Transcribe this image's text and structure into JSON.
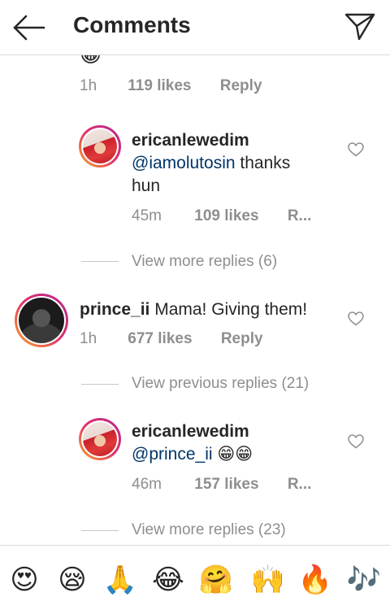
{
  "header": {
    "title": "Comments"
  },
  "top_partial": {
    "emoji": "😀",
    "time": "1h",
    "likes": "119 likes",
    "reply": "Reply"
  },
  "reply1": {
    "username": "ericanlewedim",
    "mention": "@iamolutosin",
    "text_line1": " thanks",
    "text_line2": "hun",
    "time": "45m",
    "likes": "109 likes",
    "reply": "R..."
  },
  "more1": "View more replies (6)",
  "comment2": {
    "username": "prince_ii",
    "text": " Mama! Giving them!",
    "time": "1h",
    "likes": "677 likes",
    "reply": "Reply"
  },
  "previous": "View previous replies (21)",
  "reply2": {
    "username": "ericanlewedim",
    "mention": "@prince_ii",
    "emojis": " 😁😁",
    "time": "46m",
    "likes": "157 likes",
    "reply": "R..."
  },
  "more2": "View more replies (23)",
  "emoji_bar": [
    "😍",
    "😪",
    "🙏",
    "😂",
    "🤗",
    "🙌",
    "🔥",
    "🎶"
  ]
}
